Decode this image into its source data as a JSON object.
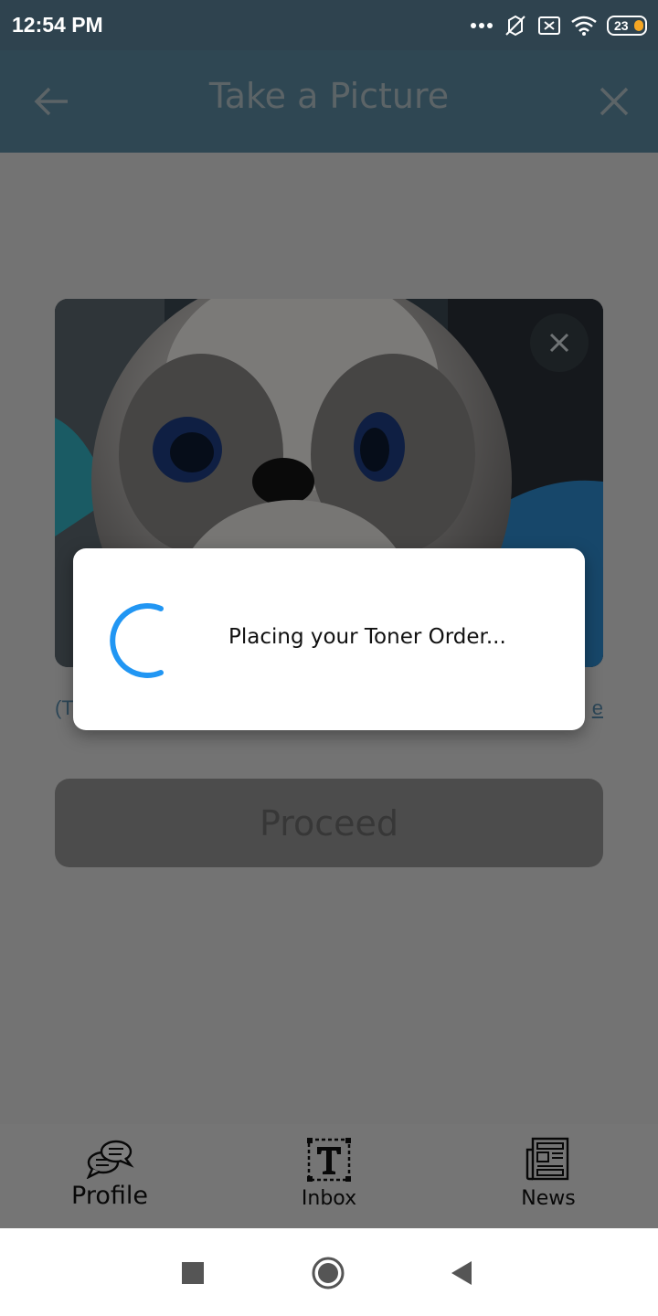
{
  "status_bar": {
    "time": "12:54 PM",
    "battery": "23",
    "icons": [
      "more-dots-icon",
      "vibrate-off-icon",
      "no-sim-icon",
      "wifi-icon",
      "battery-icon"
    ]
  },
  "header": {
    "title": "Take a Picture",
    "back_icon": "arrow-left-icon",
    "close_icon": "close-icon"
  },
  "main": {
    "caption_left": "(T",
    "caption_right": "e",
    "proceed_label": "Proceed"
  },
  "dialog": {
    "message": "Placing your Toner Order..."
  },
  "bottom_nav": {
    "items": [
      {
        "label": "Profile",
        "icon": "chat-bubbles-icon"
      },
      {
        "label": "Inbox",
        "icon": "text-box-icon"
      },
      {
        "label": "News",
        "icon": "newspaper-icon"
      }
    ]
  },
  "android_nav": {
    "icons": [
      "recents-square-icon",
      "home-circle-icon",
      "back-triangle-icon"
    ]
  },
  "colors": {
    "status_bar": "#2f434f",
    "header": "#5e8fa6",
    "spinner": "#2196f3",
    "overlay": "rgba(0,0,0,0.5)"
  }
}
